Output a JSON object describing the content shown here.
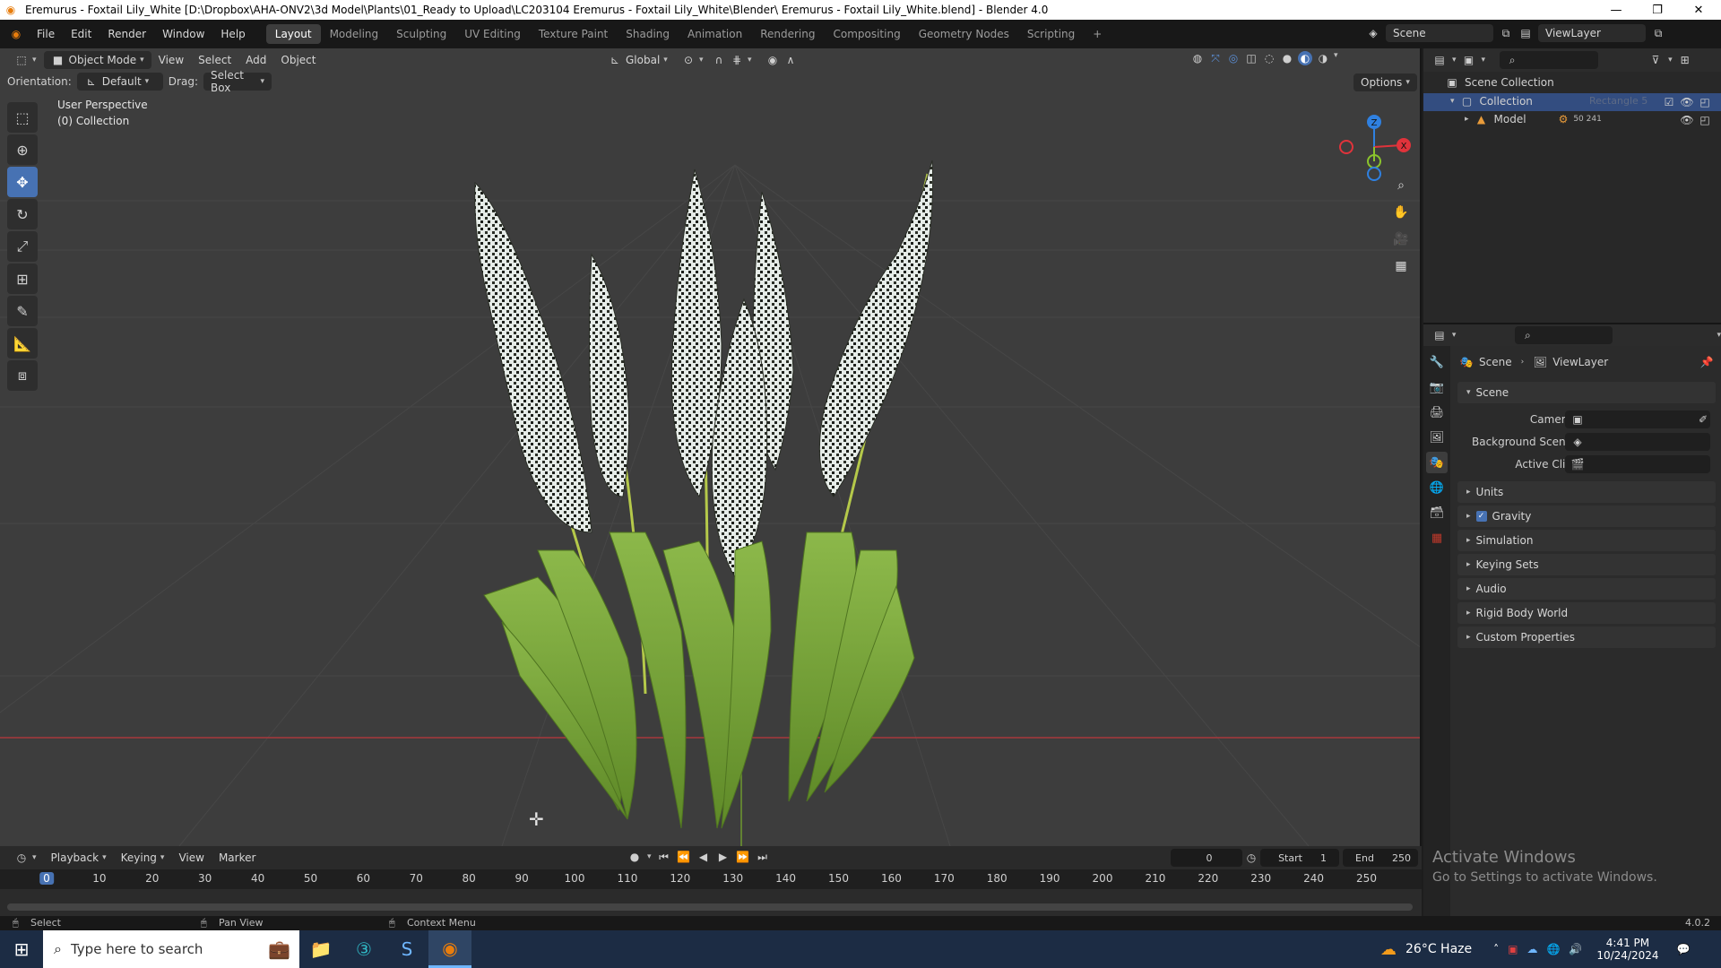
{
  "window": {
    "title": "Eremurus - Foxtail Lily_White [D:\\Dropbox\\AHA-ONV2\\3d Model\\Plants\\01_Ready to Upload\\LC203104 Eremurus - Foxtail Lily_White\\Blender\\ Eremurus - Foxtail Lily_White.blend] - Blender 4.0"
  },
  "menus": [
    "File",
    "Edit",
    "Render",
    "Window",
    "Help"
  ],
  "workspaces": [
    "Layout",
    "Modeling",
    "Sculpting",
    "UV Editing",
    "Texture Paint",
    "Shading",
    "Animation",
    "Rendering",
    "Compositing",
    "Geometry Nodes",
    "Scripting"
  ],
  "active_workspace": "Layout",
  "scene_selector": {
    "scene": "Scene",
    "view_layer": "ViewLayer"
  },
  "viewport": {
    "mode": "Object Mode",
    "header_menus": [
      "View",
      "Select",
      "Add",
      "Object"
    ],
    "transform_orientation": "Global",
    "orientation_label": "Orientation:",
    "orientation_value": "Default",
    "drag_label": "Drag:",
    "drag_value": "Select Box",
    "options": "Options",
    "info_line1": "User Perspective",
    "info_line2": "(0) Collection",
    "gizmo_labels": {
      "z": "Z",
      "y": "Y",
      "x": "X"
    }
  },
  "outliner": {
    "root": "Scene Collection",
    "collection": "Collection",
    "object": "Model",
    "object_badge": "50 241",
    "faded": "Rectangle 5"
  },
  "properties": {
    "breadcrumb_scene": "Scene",
    "breadcrumb_layer": "ViewLayer",
    "section": "Scene",
    "camera_label": "Camera",
    "bg_scene_label": "Background Scene",
    "active_clip_label": "Active Clip",
    "subpanels": [
      "Units",
      "Gravity",
      "Simulation",
      "Keying Sets",
      "Audio",
      "Rigid Body World",
      "Custom Properties"
    ]
  },
  "timeline": {
    "menus": [
      "Playback",
      "Keying",
      "View",
      "Marker"
    ],
    "current_frame": "0",
    "start_label": "Start",
    "start": "1",
    "end_label": "End",
    "end": "250",
    "ticks": [
      "0",
      "10",
      "20",
      "30",
      "40",
      "50",
      "60",
      "70",
      "80",
      "90",
      "100",
      "110",
      "120",
      "130",
      "140",
      "150",
      "160",
      "170",
      "180",
      "190",
      "200",
      "210",
      "220",
      "230",
      "240",
      "250"
    ]
  },
  "activate_windows": {
    "line1": "Activate Windows",
    "line2": "Go to Settings to activate Windows."
  },
  "statusbar": {
    "select": "Select",
    "pan": "Pan View",
    "context": "Context Menu",
    "version": "4.0.2"
  },
  "taskbar": {
    "search_placeholder": "Type here to search",
    "weather": "26°C  Haze",
    "time": "4:41 PM",
    "date": "10/24/2024"
  },
  "colors": {
    "accent": "#4772b3",
    "x_axis": "#e0333b",
    "y_axis": "#8bc42c",
    "z_axis": "#2f80e0"
  }
}
